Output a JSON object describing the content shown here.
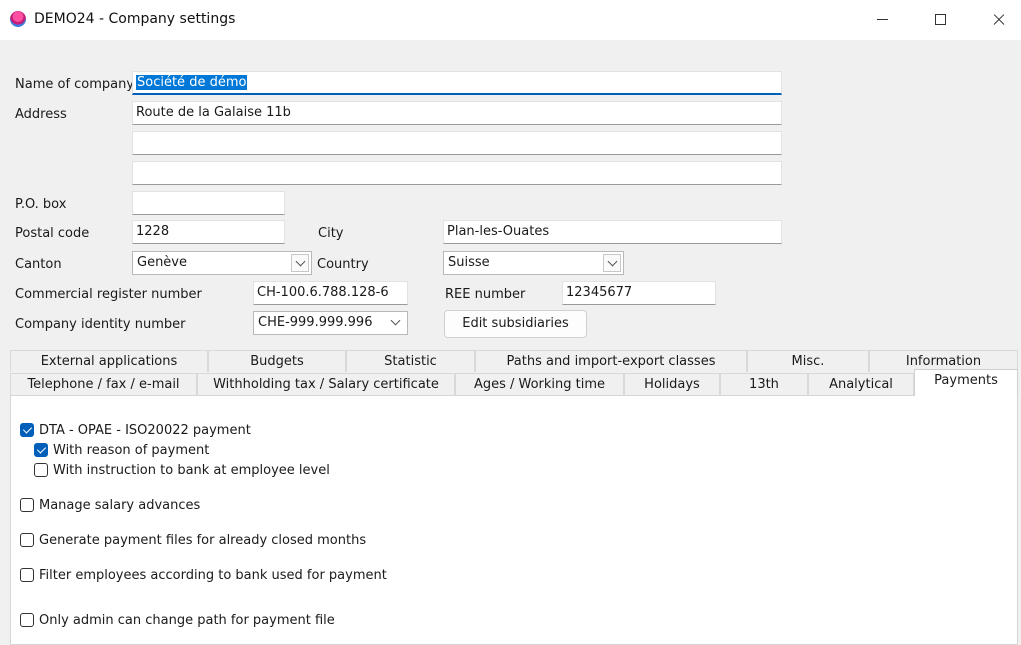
{
  "window": {
    "title": "DEMO24 - Company settings",
    "icon": "app-logo-icon"
  },
  "form": {
    "name_label": "Name of company",
    "name_value": "Société de démo",
    "address_label": "Address",
    "address_line1": "Route de la Galaise 11b",
    "address_line2": "",
    "address_line3": "",
    "pobox_label": "P.O. box",
    "pobox_value": "",
    "postal_label": "Postal code",
    "postal_value": "1228",
    "city_label": "City",
    "city_value": "Plan-les-Ouates",
    "canton_label": "Canton",
    "canton_value": "Genève",
    "country_label": "Country",
    "country_value": "Suisse",
    "commreg_label": "Commercial register number",
    "commreg_value": "CH-100.6.788.128-6",
    "ree_label": "REE number",
    "ree_value": "12345677",
    "uid_label": "Company identity number",
    "uid_value": "CHE-999.999.996",
    "edit_subsidiaries": "Edit subsidiaries"
  },
  "tabs": {
    "row1": [
      "External applications",
      "Budgets",
      "Statistic",
      "Paths and import-export classes",
      "Misc.",
      "Information"
    ],
    "row2": [
      "Telephone / fax / e-mail",
      "Withholding tax / Salary certificate",
      "Ages / Working time",
      "Holidays",
      "13th",
      "Analytical",
      "Payments"
    ],
    "active": "Payments"
  },
  "payments": [
    {
      "label": "DTA - OPAE - ISO20022 payment",
      "checked": true
    },
    {
      "label": "With reason of payment",
      "checked": true
    },
    {
      "label": "With instruction to bank at employee level",
      "checked": false
    },
    {
      "label": "Manage salary advances",
      "checked": false
    },
    {
      "label": "Generate payment files for already closed months",
      "checked": false
    },
    {
      "label": "Filter employees according to bank used for payment",
      "checked": false
    },
    {
      "label": "Only admin can change path for payment file",
      "checked": false
    }
  ],
  "colors": {
    "accent": "#005fb8",
    "selection": "#0078d7"
  }
}
